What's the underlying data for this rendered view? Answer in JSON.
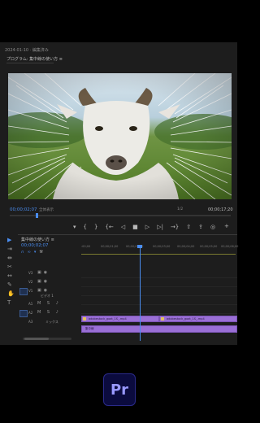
{
  "program_monitor": {
    "title": "2024-01-10 · 編集済み",
    "tab": "プログラム: 集中線の使い方 ≡",
    "timecode_current": "00;00;02;07",
    "fit": "全体表示",
    "resolution": "1/2",
    "timecode_duration": "00;00;17;20"
  },
  "transport_icons": [
    "marker-icon",
    "in-point-icon",
    "out-point-icon",
    "go-to-in-icon",
    "step-back-icon",
    "stop-icon",
    "play-icon",
    "step-forward-icon",
    "go-to-out-icon",
    "lift-icon",
    "extract-icon",
    "export-frame-icon"
  ],
  "transport_glyphs": [
    "▾",
    "{",
    "}",
    "{←",
    "◁",
    "■",
    "▷",
    "▷|",
    "→}",
    "⇧",
    "⇪",
    "◎"
  ],
  "tools": [
    "selection-tool-icon",
    "track-select-tool-icon",
    "ripple-edit-tool-icon",
    "razor-tool-icon",
    "slip-tool-icon",
    "pen-tool-icon",
    "hand-tool-icon",
    "type-tool-icon"
  ],
  "timeline": {
    "tab": "集中線の使い方 ≡",
    "timecode": "00;00;02;07",
    "ruler": [
      ":00;00",
      "00;00;01;00",
      "00;00;02;00",
      "00;00;03;00",
      "00;00;04;00",
      "00;00;05;00",
      "00;00;06;00"
    ],
    "tracks": [
      {
        "label": "V3",
        "name": ""
      },
      {
        "label": "V2",
        "name": ""
      },
      {
        "label": "V1",
        "name": "ビデオ 1"
      },
      {
        "label": "A1",
        "name": ""
      },
      {
        "label": "A2",
        "name": ""
      },
      {
        "label": "A3",
        "name": "ミックス"
      }
    ],
    "clips": [
      {
        "name": "adobestock_goat_1S_.mp4"
      },
      {
        "name": "adobestock_goat_1S_.mp4"
      },
      {
        "name": "集中線"
      }
    ]
  },
  "logo": {
    "text": "Pr"
  },
  "colors": {
    "accent": "#4a8df0",
    "clip": "#9a6fd6",
    "logo_bg": "#0b0b3e",
    "logo_text": "#9999ff"
  }
}
